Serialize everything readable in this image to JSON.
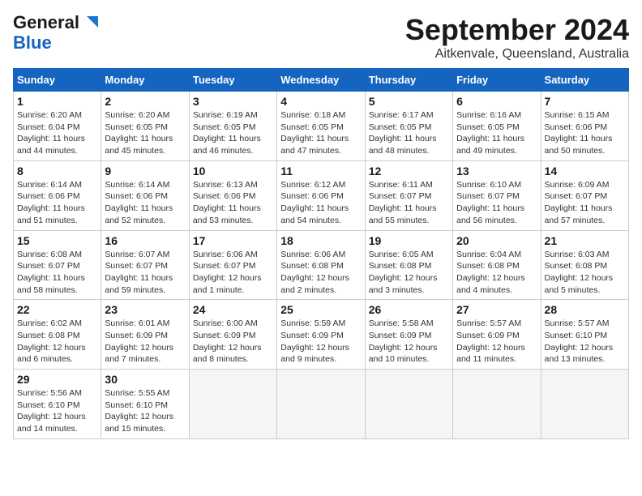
{
  "logo": {
    "line1": "General",
    "line2": "Blue"
  },
  "title": "September 2024",
  "subtitle": "Aitkenvale, Queensland, Australia",
  "days_of_week": [
    "Sunday",
    "Monday",
    "Tuesday",
    "Wednesday",
    "Thursday",
    "Friday",
    "Saturday"
  ],
  "weeks": [
    [
      {
        "day": "1",
        "sunrise": "Sunrise: 6:20 AM",
        "sunset": "Sunset: 6:04 PM",
        "daylight": "Daylight: 11 hours and 44 minutes."
      },
      {
        "day": "2",
        "sunrise": "Sunrise: 6:20 AM",
        "sunset": "Sunset: 6:05 PM",
        "daylight": "Daylight: 11 hours and 45 minutes."
      },
      {
        "day": "3",
        "sunrise": "Sunrise: 6:19 AM",
        "sunset": "Sunset: 6:05 PM",
        "daylight": "Daylight: 11 hours and 46 minutes."
      },
      {
        "day": "4",
        "sunrise": "Sunrise: 6:18 AM",
        "sunset": "Sunset: 6:05 PM",
        "daylight": "Daylight: 11 hours and 47 minutes."
      },
      {
        "day": "5",
        "sunrise": "Sunrise: 6:17 AM",
        "sunset": "Sunset: 6:05 PM",
        "daylight": "Daylight: 11 hours and 48 minutes."
      },
      {
        "day": "6",
        "sunrise": "Sunrise: 6:16 AM",
        "sunset": "Sunset: 6:05 PM",
        "daylight": "Daylight: 11 hours and 49 minutes."
      },
      {
        "day": "7",
        "sunrise": "Sunrise: 6:15 AM",
        "sunset": "Sunset: 6:06 PM",
        "daylight": "Daylight: 11 hours and 50 minutes."
      }
    ],
    [
      {
        "day": "8",
        "sunrise": "Sunrise: 6:14 AM",
        "sunset": "Sunset: 6:06 PM",
        "daylight": "Daylight: 11 hours and 51 minutes."
      },
      {
        "day": "9",
        "sunrise": "Sunrise: 6:14 AM",
        "sunset": "Sunset: 6:06 PM",
        "daylight": "Daylight: 11 hours and 52 minutes."
      },
      {
        "day": "10",
        "sunrise": "Sunrise: 6:13 AM",
        "sunset": "Sunset: 6:06 PM",
        "daylight": "Daylight: 11 hours and 53 minutes."
      },
      {
        "day": "11",
        "sunrise": "Sunrise: 6:12 AM",
        "sunset": "Sunset: 6:06 PM",
        "daylight": "Daylight: 11 hours and 54 minutes."
      },
      {
        "day": "12",
        "sunrise": "Sunrise: 6:11 AM",
        "sunset": "Sunset: 6:07 PM",
        "daylight": "Daylight: 11 hours and 55 minutes."
      },
      {
        "day": "13",
        "sunrise": "Sunrise: 6:10 AM",
        "sunset": "Sunset: 6:07 PM",
        "daylight": "Daylight: 11 hours and 56 minutes."
      },
      {
        "day": "14",
        "sunrise": "Sunrise: 6:09 AM",
        "sunset": "Sunset: 6:07 PM",
        "daylight": "Daylight: 11 hours and 57 minutes."
      }
    ],
    [
      {
        "day": "15",
        "sunrise": "Sunrise: 6:08 AM",
        "sunset": "Sunset: 6:07 PM",
        "daylight": "Daylight: 11 hours and 58 minutes."
      },
      {
        "day": "16",
        "sunrise": "Sunrise: 6:07 AM",
        "sunset": "Sunset: 6:07 PM",
        "daylight": "Daylight: 11 hours and 59 minutes."
      },
      {
        "day": "17",
        "sunrise": "Sunrise: 6:06 AM",
        "sunset": "Sunset: 6:07 PM",
        "daylight": "Daylight: 12 hours and 1 minute."
      },
      {
        "day": "18",
        "sunrise": "Sunrise: 6:06 AM",
        "sunset": "Sunset: 6:08 PM",
        "daylight": "Daylight: 12 hours and 2 minutes."
      },
      {
        "day": "19",
        "sunrise": "Sunrise: 6:05 AM",
        "sunset": "Sunset: 6:08 PM",
        "daylight": "Daylight: 12 hours and 3 minutes."
      },
      {
        "day": "20",
        "sunrise": "Sunrise: 6:04 AM",
        "sunset": "Sunset: 6:08 PM",
        "daylight": "Daylight: 12 hours and 4 minutes."
      },
      {
        "day": "21",
        "sunrise": "Sunrise: 6:03 AM",
        "sunset": "Sunset: 6:08 PM",
        "daylight": "Daylight: 12 hours and 5 minutes."
      }
    ],
    [
      {
        "day": "22",
        "sunrise": "Sunrise: 6:02 AM",
        "sunset": "Sunset: 6:08 PM",
        "daylight": "Daylight: 12 hours and 6 minutes."
      },
      {
        "day": "23",
        "sunrise": "Sunrise: 6:01 AM",
        "sunset": "Sunset: 6:09 PM",
        "daylight": "Daylight: 12 hours and 7 minutes."
      },
      {
        "day": "24",
        "sunrise": "Sunrise: 6:00 AM",
        "sunset": "Sunset: 6:09 PM",
        "daylight": "Daylight: 12 hours and 8 minutes."
      },
      {
        "day": "25",
        "sunrise": "Sunrise: 5:59 AM",
        "sunset": "Sunset: 6:09 PM",
        "daylight": "Daylight: 12 hours and 9 minutes."
      },
      {
        "day": "26",
        "sunrise": "Sunrise: 5:58 AM",
        "sunset": "Sunset: 6:09 PM",
        "daylight": "Daylight: 12 hours and 10 minutes."
      },
      {
        "day": "27",
        "sunrise": "Sunrise: 5:57 AM",
        "sunset": "Sunset: 6:09 PM",
        "daylight": "Daylight: 12 hours and 11 minutes."
      },
      {
        "day": "28",
        "sunrise": "Sunrise: 5:57 AM",
        "sunset": "Sunset: 6:10 PM",
        "daylight": "Daylight: 12 hours and 13 minutes."
      }
    ],
    [
      {
        "day": "29",
        "sunrise": "Sunrise: 5:56 AM",
        "sunset": "Sunset: 6:10 PM",
        "daylight": "Daylight: 12 hours and 14 minutes."
      },
      {
        "day": "30",
        "sunrise": "Sunrise: 5:55 AM",
        "sunset": "Sunset: 6:10 PM",
        "daylight": "Daylight: 12 hours and 15 minutes."
      },
      null,
      null,
      null,
      null,
      null
    ]
  ]
}
